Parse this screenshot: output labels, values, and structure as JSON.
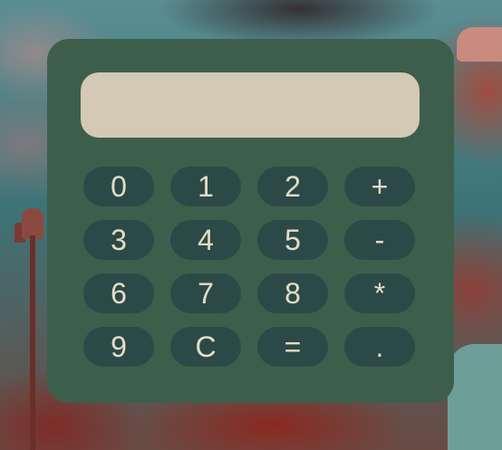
{
  "display": {
    "value": ""
  },
  "keys": [
    {
      "label": "0",
      "name": "key-0-button"
    },
    {
      "label": "1",
      "name": "key-1-button"
    },
    {
      "label": "2",
      "name": "key-2-button"
    },
    {
      "label": "+",
      "name": "key-plus-button"
    },
    {
      "label": "3",
      "name": "key-3-button"
    },
    {
      "label": "4",
      "name": "key-4-button"
    },
    {
      "label": "5",
      "name": "key-5-button"
    },
    {
      "label": "-",
      "name": "key-minus-button"
    },
    {
      "label": "6",
      "name": "key-6-button"
    },
    {
      "label": "7",
      "name": "key-7-button"
    },
    {
      "label": "8",
      "name": "key-8-button"
    },
    {
      "label": "*",
      "name": "key-multiply-button"
    },
    {
      "label": "9",
      "name": "key-9-button"
    },
    {
      "label": "C",
      "name": "key-clear-button"
    },
    {
      "label": "=",
      "name": "key-equals-button"
    },
    {
      "label": ".",
      "name": "key-decimal-button"
    }
  ],
  "colors": {
    "panel": "#3e5e4c",
    "display": "#d4c9b4",
    "key": "#2b4a47",
    "key_text": "#e4dcc7"
  }
}
